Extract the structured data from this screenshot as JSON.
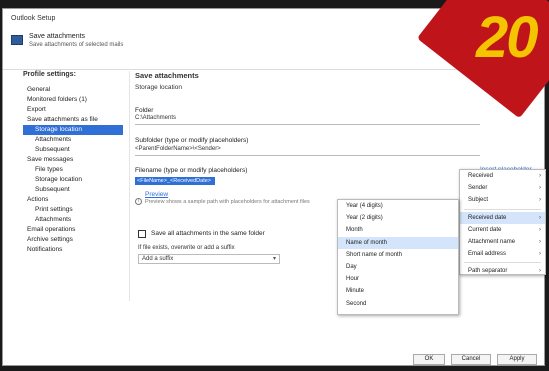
{
  "window": {
    "title": "Outlook Setup",
    "app_name": "Save attachments",
    "app_desc": "Save attachments of selected mails"
  },
  "sidebar": {
    "heading": "Profile settings:",
    "items": [
      {
        "label": "General",
        "level": 1,
        "active": false
      },
      {
        "label": "Monitored folders (1)",
        "level": 1,
        "active": false
      },
      {
        "label": "Export",
        "level": 1,
        "active": false
      },
      {
        "label": "Save attachments as file",
        "level": 1,
        "active": false
      },
      {
        "label": "Storage location",
        "level": 2,
        "active": true
      },
      {
        "label": "Attachments",
        "level": 2,
        "active": false
      },
      {
        "label": "Subsequent",
        "level": 2,
        "active": false
      },
      {
        "label": "Save messages",
        "level": 1,
        "active": false
      },
      {
        "label": "File types",
        "level": 2,
        "active": false
      },
      {
        "label": "Storage location",
        "level": 2,
        "active": false
      },
      {
        "label": "Subsequent",
        "level": 2,
        "active": false
      },
      {
        "label": "Actions",
        "level": 1,
        "active": false
      },
      {
        "label": "Print settings",
        "level": 2,
        "active": false
      },
      {
        "label": "Attachments",
        "level": 2,
        "active": false
      },
      {
        "label": "Email operations",
        "level": 1,
        "active": false
      },
      {
        "label": "Archive settings",
        "level": 1,
        "active": false
      },
      {
        "label": "Notifications",
        "level": 1,
        "active": false
      }
    ]
  },
  "main": {
    "title": "Save attachments",
    "subtitle": "Storage location",
    "folder_label": "Folder",
    "folder_value": "C:\\Attachments",
    "subfolder_label": "Subfolder (type or modify placeholders)",
    "subfolder_value": "<ParentFolderName>\\<Sender>",
    "filename_label": "Filename (type or modify placeholders)",
    "filename_value": "<FileName>_<ReceivedDate>",
    "insert_placeholder_link": "Insert placeholder",
    "preview_link": "Preview",
    "note": "Preview shows a sample path with placeholders for attachment files",
    "checkbox_label": "Save all attachments in the same folder",
    "combo_label": "If file exists, overwrite or add a suffix",
    "combo_value": "Add a suffix"
  },
  "menu_main": [
    {
      "label": "Received",
      "has_arrow": true,
      "highlight": false
    },
    {
      "label": "Sender",
      "has_arrow": true,
      "highlight": false
    },
    {
      "label": "Subject",
      "has_arrow": true,
      "highlight": false
    },
    {
      "label": "Received date",
      "has_arrow": true,
      "highlight": true
    },
    {
      "label": "Current date",
      "has_arrow": true,
      "highlight": false
    },
    {
      "label": "Attachment name",
      "has_arrow": true,
      "highlight": false
    },
    {
      "label": "Email address",
      "has_arrow": true,
      "highlight": false
    },
    {
      "label": "Path separator",
      "has_arrow": true,
      "highlight": false
    }
  ],
  "menu_sub": [
    {
      "label": "Year (4 digits)",
      "highlight": false
    },
    {
      "label": "Year (2 digits)",
      "highlight": false
    },
    {
      "label": "Month",
      "highlight": false
    },
    {
      "label": "Name of month",
      "highlight": true
    },
    {
      "label": "Short name of month",
      "highlight": false
    },
    {
      "label": "Day",
      "highlight": false
    },
    {
      "label": "Hour",
      "highlight": false
    },
    {
      "label": "Minute",
      "highlight": false
    },
    {
      "label": "Second",
      "highlight": false
    }
  ],
  "footer": {
    "ok": "OK",
    "cancel": "Cancel",
    "apply": "Apply"
  },
  "badge": {
    "number": "20",
    "bg_color": "#c0141b",
    "text_color": "#f5c400"
  }
}
